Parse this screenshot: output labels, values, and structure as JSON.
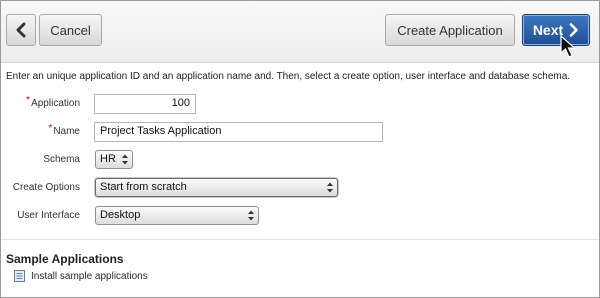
{
  "toolbar": {
    "back_icon": "chevron-left-icon",
    "cancel_label": "Cancel",
    "create_label": "Create Application",
    "next_label": "Next",
    "next_icon": "chevron-right-icon",
    "accent": "#2a5ea5"
  },
  "intro": "Enter an unique application ID and an application name and. Then, select a create option, user interface and database schema.",
  "form": {
    "application": {
      "label": "Application",
      "value": "100",
      "required": true
    },
    "name": {
      "label": "Name",
      "value": "Project Tasks Application",
      "required": true
    },
    "schema": {
      "label": "Schema",
      "value": "HR"
    },
    "create_options": {
      "label": "Create Options",
      "value": "Start from scratch"
    },
    "user_interface": {
      "label": "User Interface",
      "value": "Desktop"
    }
  },
  "required_marker": "*",
  "sample": {
    "title": "Sample Applications",
    "link_label": "Install sample applications",
    "link_icon": "document-icon"
  }
}
